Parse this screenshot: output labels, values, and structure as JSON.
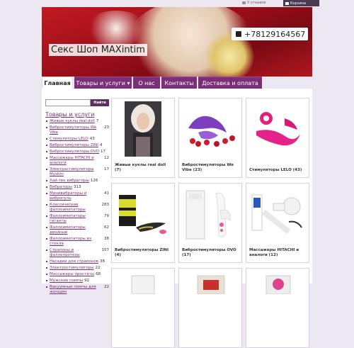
{
  "topbar": {
    "reviews_label": "0 отзывов",
    "cart_label": "Корзина"
  },
  "header": {
    "phone": "+78129164567",
    "shop_name": "Секс Шоп MAXintim"
  },
  "nav": [
    {
      "label": "Главная",
      "active": true
    },
    {
      "label": "Товары и услуги ▾",
      "active": false
    },
    {
      "label": "О нас",
      "active": false
    },
    {
      "label": "Контакты",
      "active": false
    },
    {
      "label": "Доставка и оплата",
      "active": false
    }
  ],
  "search": {
    "button_label": "Найти",
    "placeholder": ""
  },
  "sidebar": {
    "heading": "Товары и услуги",
    "categories": [
      {
        "name": "Живые куклы real doll",
        "count": "7"
      },
      {
        "name": "Вибростимуляторы We Vibe",
        "count": "23"
      },
      {
        "name": "Стимуляторы LELO",
        "count": "43"
      },
      {
        "name": "Вибростимуляторы ZINI",
        "count": "4"
      },
      {
        "name": "Вибростимуляторы OVO",
        "count": "17"
      },
      {
        "name": "Массажеры HITACHI и аналоги",
        "count": "12"
      },
      {
        "name": "Электростимуляторы Mystim",
        "count": "17"
      },
      {
        "name": "Хай-тек вибраторы",
        "count": "126"
      },
      {
        "name": "Вибраторы",
        "count": "313"
      },
      {
        "name": "Минивибраторы и вибропуль",
        "count": "41"
      },
      {
        "name": "Классические фаллоимитаторы",
        "count": "283"
      },
      {
        "name": "Фаллоимитаторы гиганты",
        "count": "79"
      },
      {
        "name": "Фаллоимитаторы двойные",
        "count": "62"
      },
      {
        "name": "Фаллоимитаторы из стекла",
        "count": "38"
      },
      {
        "name": "Страпоны и фаллопротезы",
        "count": "107"
      },
      {
        "name": "Насадки для страпонов",
        "count": "38"
      },
      {
        "name": "Электростимуляторы",
        "count": "22"
      },
      {
        "name": "Массажеры простаты",
        "count": "68"
      },
      {
        "name": "Мужские помпы",
        "count": "92"
      },
      {
        "name": "Вакуумные помпы для женщин",
        "count": "22"
      }
    ]
  },
  "products": [
    {
      "title": "Живые куклы real doll (7)"
    },
    {
      "title": "Вибростимуляторы We Vibe (23)"
    },
    {
      "title": "Стимуляторы LELO (43)"
    },
    {
      "title": "Вибростимуляторы ZINI (4)"
    },
    {
      "title": "Вибростимуляторы OVO (17)"
    },
    {
      "title": "Массажеры HITACHI и аналоги (12)"
    },
    {
      "title": ""
    },
    {
      "title": ""
    },
    {
      "title": ""
    }
  ],
  "colors": {
    "accent": "#7a2f77",
    "background": "#ece7f0"
  }
}
